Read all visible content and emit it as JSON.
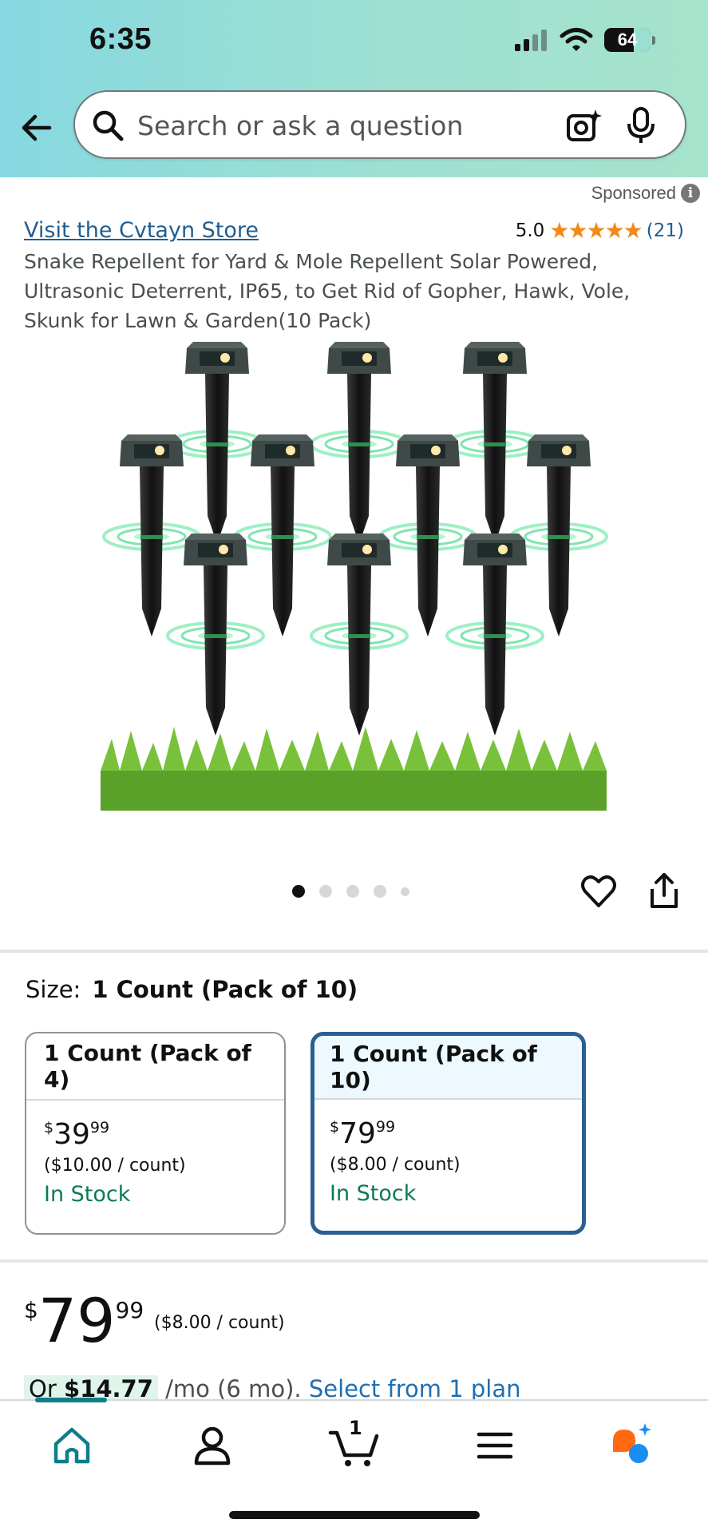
{
  "status_bar": {
    "time": "6:35",
    "battery": "64"
  },
  "search": {
    "placeholder": "Search or ask a question"
  },
  "sponsored": {
    "label": "Sponsored",
    "info": "i"
  },
  "product": {
    "store_link": "Visit the Cvtayn Store",
    "rating": "5.0",
    "stars": "★★★★★",
    "review_count": "(21)",
    "title": "Snake Repellent for Yard & Mole Repellent Solar Powered, Ultrasonic Deterrent, IP65, to Get Rid of Gopher, Hawk, Vole, Skunk for Lawn & Garden(10 Pack)"
  },
  "gallery": {
    "count": 5,
    "active_index": 0
  },
  "size": {
    "label": "Size:",
    "selected": "1 Count (Pack of 10)",
    "options": [
      {
        "name": "1 Count (Pack of 4)",
        "currency": "$",
        "whole": "39",
        "fraction": "99",
        "unit_price": "($10.00 / count)",
        "stock": "In Stock",
        "selected": false
      },
      {
        "name": "1 Count (Pack of 10)",
        "currency": "$",
        "whole": "79",
        "fraction": "99",
        "unit_price": "($8.00 / count)",
        "stock": "In Stock",
        "selected": true
      }
    ]
  },
  "price": {
    "currency": "$",
    "whole": "79",
    "fraction": "99",
    "unit_price": "($8.00 / count)",
    "monthly_prefix": "Or ",
    "monthly_amount": "$14.77",
    "monthly_suffix": " /mo (6 mo). ",
    "plan_link": "Select from 1 plan"
  },
  "nav": {
    "cart_count": "1"
  },
  "colors": {
    "accent_teal": "#0e7e8a",
    "link_blue": "#1f5e91",
    "star_orange": "#f08a1a",
    "stock_green": "#0a7a5a",
    "selected_border": "#2a5f90"
  }
}
